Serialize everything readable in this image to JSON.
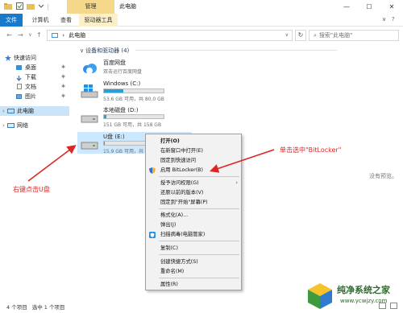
{
  "titlebar": {
    "manage_tab": "管理",
    "window_title": "此电脑",
    "minimize": "—",
    "maximize": "☐",
    "close": "✕"
  },
  "ribbon": {
    "tabs": [
      {
        "label": "文件"
      },
      {
        "label": "计算机"
      },
      {
        "label": "查看"
      },
      {
        "label": "驱动器工具"
      }
    ],
    "collapse_glyph": "∨",
    "help_glyph": "?"
  },
  "address_bar": {
    "back": "←",
    "forward": "→",
    "recent": "∨",
    "up": "↑",
    "path_separator": "›",
    "path": "此电脑",
    "dropdown": "∨",
    "refresh": "↻",
    "search_placeholder": "搜索\"此电脑\""
  },
  "navigation": {
    "quick_access": "快速访问",
    "items": [
      {
        "label": "桌面"
      },
      {
        "label": "下载"
      },
      {
        "label": "文档"
      },
      {
        "label": "图片"
      }
    ],
    "this_pc": "此电脑",
    "network": "网络",
    "pin_glyph": "✱",
    "expand_glyph": "›"
  },
  "content": {
    "group_header": "设备和驱动器 (4)",
    "drives": [
      {
        "name": "百度网盘",
        "sub": "双击运行百度网盘"
      },
      {
        "name": "Windows (C:)",
        "capacity": "53.6 GB 可用，共 80.0 GB",
        "used_fraction": 0.33
      },
      {
        "name": "本地磁盘 (D:)",
        "capacity": "151 GB 可用，共 158 GB",
        "used_fraction": 0.04
      },
      {
        "name": "U盘 (E:)",
        "capacity": "15.9 GB 可用，共",
        "used_fraction": 0.02
      }
    ],
    "no_preview": "没有预览。"
  },
  "context_menu": {
    "items": [
      {
        "label": "打开(O)",
        "bold": true
      },
      {
        "label": "在新窗口中打开(E)"
      },
      {
        "label": "固定到快速访问"
      },
      {
        "label": "启用 BitLocker(B)",
        "icon": "shield-icon"
      },
      {
        "label": "授予访问权限(G)",
        "submenu": true
      },
      {
        "label": "还原以前的版本(V)"
      },
      {
        "label": "固定到\"开始\"屏幕(P)"
      },
      {
        "label": "格式化(A)..."
      },
      {
        "label": "弹出(J)"
      },
      {
        "label": "扫描病毒(电脑管家)",
        "icon": "tencent-shield-icon"
      },
      {
        "label": "复制(C)"
      },
      {
        "label": "创建快捷方式(S)"
      },
      {
        "label": "重命名(M)"
      },
      {
        "label": "属性(R)"
      }
    ],
    "submenu_glyph": "›"
  },
  "statusbar": {
    "count": "4 个项目",
    "selected": "选中 1 个项目"
  },
  "annotations": {
    "left": "右键点击U盘",
    "right": "单击选中\"BitLocker\""
  },
  "watermark": {
    "text": "纯净系统之家",
    "url": "www.ycwjzy.com"
  },
  "colors": {
    "accent": "#1979ca",
    "selection": "#cce8ff",
    "manage_tab": "#f5d88a",
    "annotation": "#e02424",
    "progress": "#26a0da"
  }
}
